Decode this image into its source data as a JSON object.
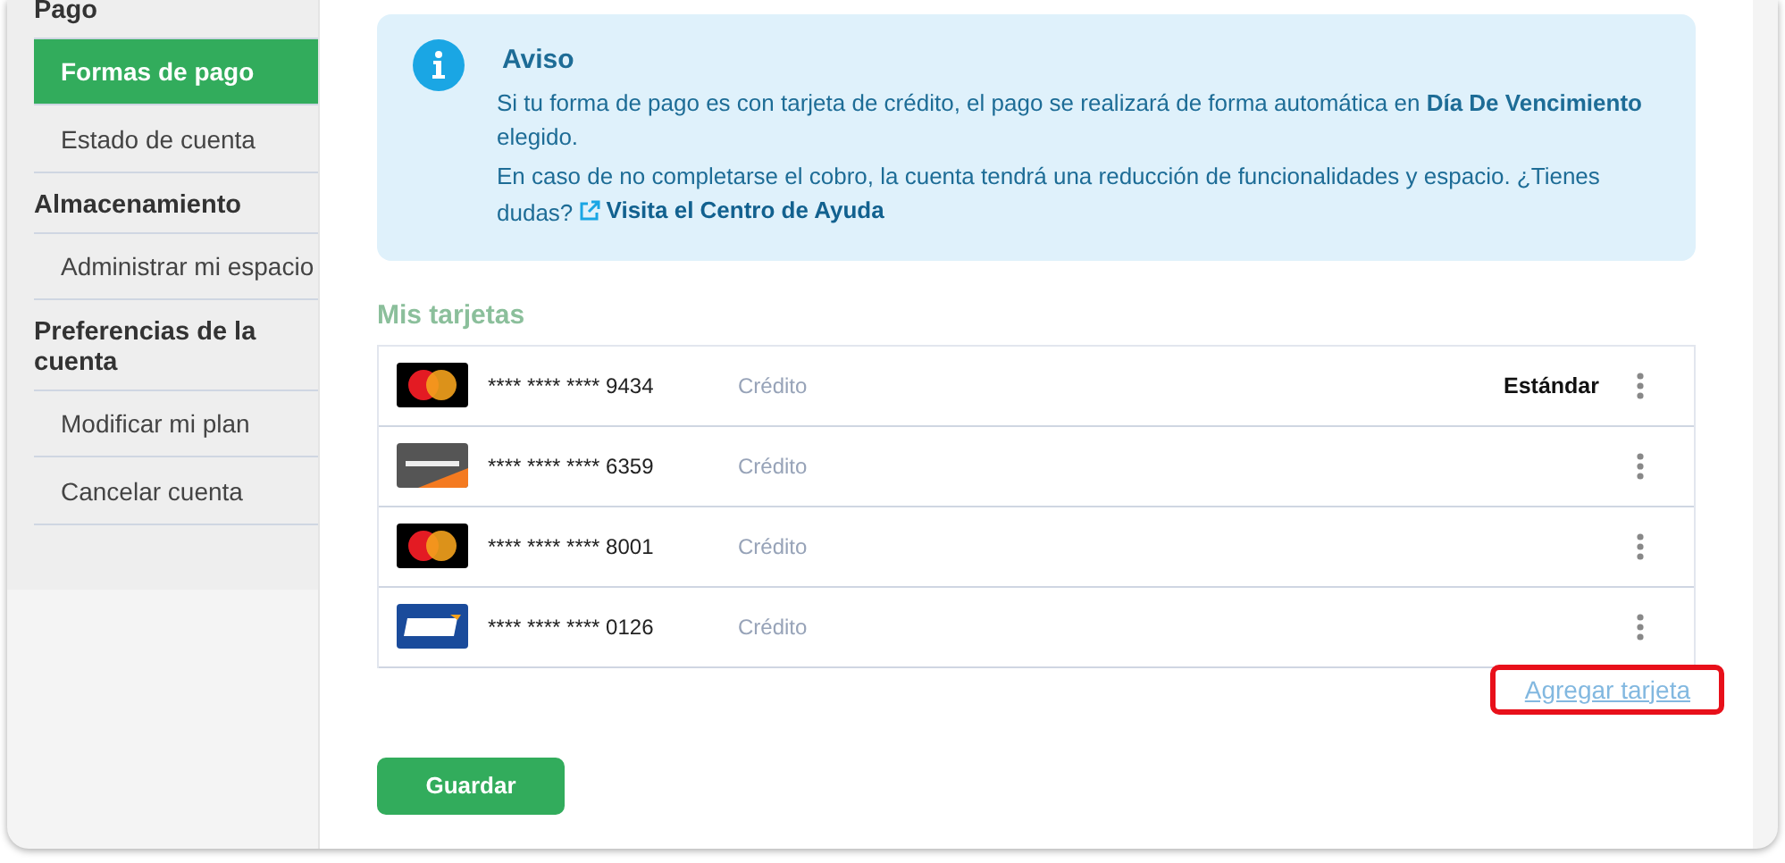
{
  "sidebar": {
    "sections": [
      {
        "title": "Pago",
        "items": [
          {
            "label": "Formas de pago",
            "selected": true
          },
          {
            "label": "Estado de cuenta",
            "selected": false
          }
        ]
      },
      {
        "title": "Almacenamiento",
        "items": [
          {
            "label": "Administrar mi espacio",
            "selected": false
          }
        ]
      },
      {
        "title": "Preferencias de la cuenta",
        "items": [
          {
            "label": "Modificar mi plan",
            "selected": false
          },
          {
            "label": "Cancelar cuenta",
            "selected": false
          }
        ]
      }
    ]
  },
  "notice": {
    "title": "Aviso",
    "paragraphs": [
      "Si tu forma de pago es con tarjeta de crédito, el pago se realizará de forma automática en **Día De Vencimiento** elegido.",
      "En caso de no completarse el cobro, la cuenta tendrá una reducción de funcionalidades y espacio. ¿Tienes dudas?"
    ],
    "link": "Visita el Centro de Ayuda"
  },
  "cards_title": "Mis tarjetas",
  "cards": [
    {
      "kind": "mastercard",
      "number": "**** **** **** 9434",
      "type": "Crédito",
      "tag": "Estándar"
    },
    {
      "kind": "discover",
      "number": "**** **** **** 6359",
      "type": "Crédito"
    },
    {
      "kind": "mastercard",
      "number": "**** **** **** 8001",
      "type": "Crédito"
    },
    {
      "kind": "visa",
      "number": "**** **** **** 0126",
      "type": "Crédito"
    }
  ],
  "add_card": {
    "label": "Agregar tarjeta",
    "highlighted": true
  },
  "save_button": "Guardar"
}
